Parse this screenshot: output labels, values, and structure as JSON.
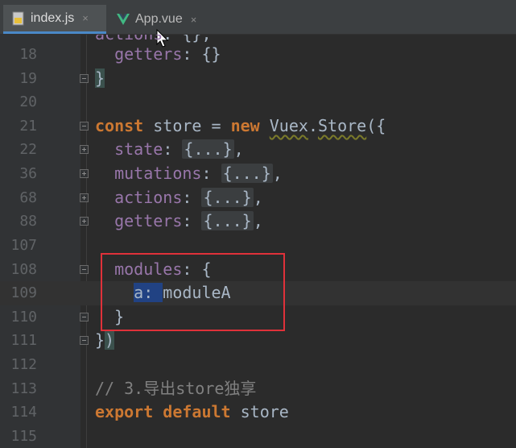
{
  "tabs": [
    {
      "label": "index.js",
      "icon": "js-file-icon",
      "active": true
    },
    {
      "label": "App.vue",
      "icon": "vue-file-icon",
      "active": false
    }
  ],
  "close_glyph": "×",
  "lines": [
    {
      "n": "",
      "text": "  actions: {},"
    },
    {
      "n": "18",
      "text": "  getters: {}"
    },
    {
      "n": "19",
      "text": "}"
    },
    {
      "n": "20",
      "text": ""
    },
    {
      "n": "21",
      "text": "const store = new Vuex.Store({"
    },
    {
      "n": "22",
      "text": "  state: {...},"
    },
    {
      "n": "36",
      "text": "  mutations: {...},"
    },
    {
      "n": "68",
      "text": "  actions: {...},"
    },
    {
      "n": "88",
      "text": "  getters: {...},"
    },
    {
      "n": "107",
      "text": ""
    },
    {
      "n": "108",
      "text": "  modules: {"
    },
    {
      "n": "109",
      "text": "    a: moduleA"
    },
    {
      "n": "110",
      "text": "  }"
    },
    {
      "n": "111",
      "text": "})"
    },
    {
      "n": "112",
      "text": ""
    },
    {
      "n": "113",
      "text": "// 3.导出store独享"
    },
    {
      "n": "114",
      "text": "export default store"
    },
    {
      "n": "115",
      "text": ""
    }
  ],
  "code": {
    "l17_prop": "actions",
    "l17_rest": ": {},",
    "l18_prop": "getters",
    "l18_rest": ": {}",
    "l19": "}",
    "l21_kw1": "const",
    "l21_mid": " store = ",
    "l21_kw2": "new",
    "l21_cls1": "Vuex",
    "l21_dot": ".",
    "l21_cls2": "Store",
    "l21_end": "({",
    "l22_prop": "state",
    "l36_prop": "mutations",
    "l68_prop": "actions",
    "l88_prop": "getters",
    "colon": ": ",
    "folded": "{...}",
    "comma": ",",
    "l108_prop": "modules",
    "l108_rest": ": {",
    "l109_sel": "a: ",
    "l109_rest": "moduleA",
    "l110": "}",
    "l111_a": "}",
    "l111_b": ")",
    "l113": "// 3.导出store独享",
    "l114_kw1": "export",
    "l114_kw2": "default",
    "l114_rest": " store"
  },
  "colors": {
    "background": "#2b2b2b",
    "keyword": "#cc7832",
    "property": "#9876aa",
    "comment": "#808080",
    "annotation_box": "#e0313a"
  }
}
